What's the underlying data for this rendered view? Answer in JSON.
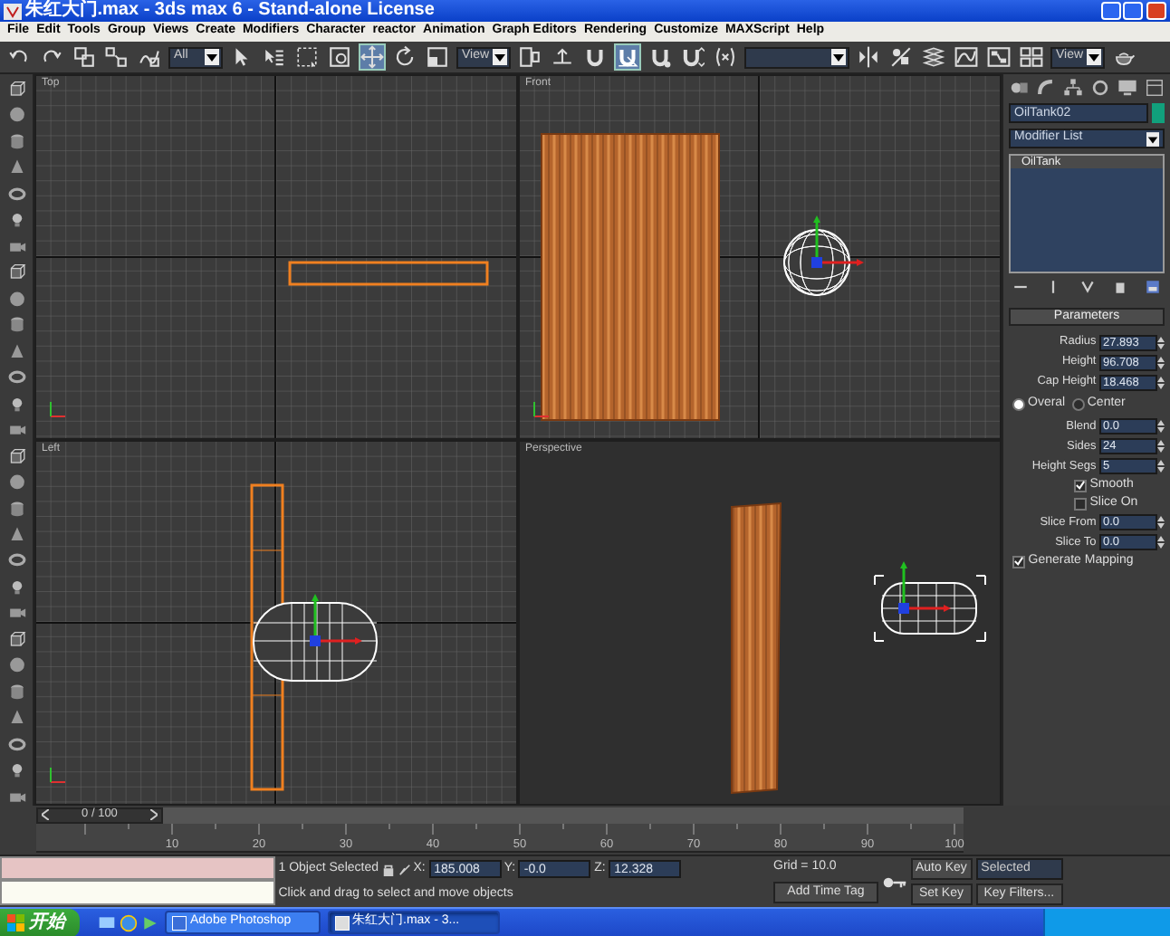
{
  "window": {
    "title": "朱红大门.max - 3ds max 6 - Stand-alone License"
  },
  "menu": [
    "File",
    "Edit",
    "Tools",
    "Group",
    "Views",
    "Create",
    "Modifiers",
    "Character",
    "reactor",
    "Animation",
    "Graph Editors",
    "Rendering",
    "Customize",
    "MAXScript",
    "Help"
  ],
  "toolbar": [
    {
      "kind": "undo"
    },
    {
      "kind": "redo"
    },
    {
      "kind": "link"
    },
    {
      "kind": "unlink"
    },
    {
      "kind": "bind"
    },
    {
      "kind": "dropdown",
      "value": "All"
    },
    {
      "kind": "pointer",
      "selected": false
    },
    {
      "kind": "select-by-name"
    },
    {
      "kind": "region"
    },
    {
      "kind": "window"
    },
    {
      "kind": "move",
      "selected": true
    },
    {
      "kind": "rotate",
      "selected": false
    },
    {
      "kind": "scale",
      "selected": false
    },
    {
      "kind": "dropdown",
      "value": "View"
    },
    {
      "kind": "pivot"
    },
    {
      "kind": "manipulate"
    },
    {
      "kind": "snap",
      "selected": false
    },
    {
      "kind": "angle-snap",
      "selected": true
    },
    {
      "kind": "percent-snap",
      "selected": false
    },
    {
      "kind": "spinner-snap",
      "selected": false
    },
    {
      "kind": "named-selection"
    },
    {
      "kind": "dropdown"
    },
    {
      "kind": "mirror"
    },
    {
      "kind": "align"
    },
    {
      "kind": "layers"
    },
    {
      "kind": "curve-editor"
    },
    {
      "kind": "schematic"
    },
    {
      "kind": "material-editor"
    },
    {
      "kind": "dropdown",
      "value": "View"
    },
    {
      "kind": "render"
    }
  ],
  "viewports": [
    {
      "kind": "top",
      "label": "Top"
    },
    {
      "kind": "front",
      "label": "Front"
    },
    {
      "kind": "left",
      "label": "Left"
    },
    {
      "kind": "perspective",
      "label": "Perspective"
    }
  ],
  "command_panel": {
    "object": {
      "name": "OilTank02",
      "color": "#11a07c"
    },
    "modifier_list": "Modifier List",
    "stack": [
      {
        "label": "OilTank",
        "selected": true
      }
    ],
    "rollout": {
      "title": "Parameters",
      "fields": [
        {
          "kind": "spinner",
          "label": "Radius",
          "value": "27.893"
        },
        {
          "kind": "spinner",
          "label": "Height",
          "value": "96.708"
        },
        {
          "kind": "spinner",
          "label": "Cap Height",
          "value": "18.468"
        },
        {
          "kind": "radio",
          "label": "Overal",
          "selected": true
        },
        {
          "kind": "radio",
          "label": "Center",
          "selected": false
        },
        {
          "kind": "spinner",
          "label": "Blend",
          "value": "0.0"
        },
        {
          "kind": "spinner",
          "label": "Sides",
          "value": "24"
        },
        {
          "kind": "spinner",
          "label": "Height Segs",
          "value": "5"
        },
        {
          "kind": "checkbox",
          "label": "Smooth",
          "checked": true
        },
        {
          "kind": "checkbox",
          "label": "Slice On",
          "checked": false
        },
        {
          "kind": "spinner",
          "label": "Slice From",
          "value": "0.0"
        },
        {
          "kind": "spinner",
          "label": "Slice To",
          "value": "0.0"
        },
        {
          "kind": "checkbox",
          "label": "Generate Mapping",
          "checked": true
        }
      ]
    }
  },
  "time_slider": {
    "label": "0 / 100",
    "level": 0
  },
  "track_ticks": [
    "10",
    "20",
    "30",
    "40",
    "50",
    "60",
    "70",
    "80",
    "90",
    "100"
  ],
  "status": {
    "selection": "1 Object Selected",
    "coords": [
      {
        "axis": "X:",
        "value": "185.008"
      },
      {
        "axis": "Y:",
        "value": "-0.0"
      },
      {
        "axis": "Z:",
        "value": "12.328"
      }
    ],
    "grid": "Grid = 10.0",
    "prompt": "Click and drag to select and move objects",
    "time_tag": "Add Time Tag",
    "auto_key": "Auto Key",
    "key_mode": "Selected",
    "set_key": "Set Key",
    "key_filters": "Key Filters..."
  },
  "taskbar": {
    "start": "开始",
    "tasks": [
      {
        "label": "Adobe Photoshop",
        "selected": false
      },
      {
        "label": "朱红大门.max - 3...",
        "selected": true
      }
    ]
  }
}
